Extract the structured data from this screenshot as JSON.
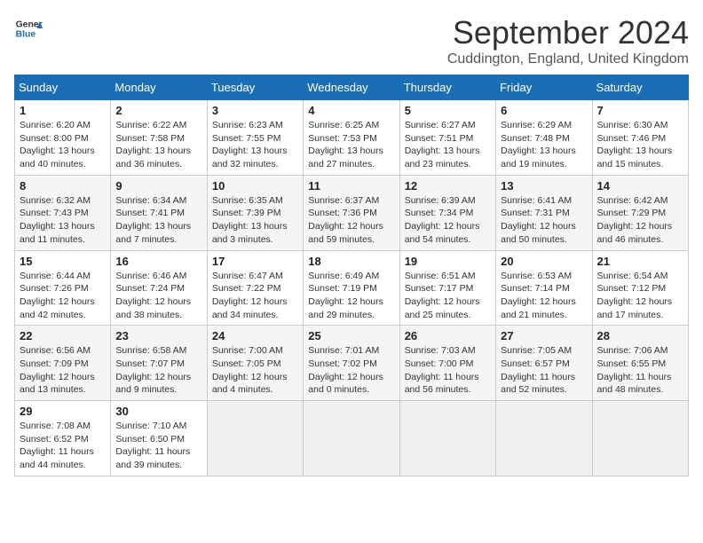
{
  "header": {
    "logo_line1": "General",
    "logo_line2": "Blue",
    "month": "September 2024",
    "location": "Cuddington, England, United Kingdom"
  },
  "weekdays": [
    "Sunday",
    "Monday",
    "Tuesday",
    "Wednesday",
    "Thursday",
    "Friday",
    "Saturday"
  ],
  "weeks": [
    [
      {
        "day": "1",
        "info": "Sunrise: 6:20 AM\nSunset: 8:00 PM\nDaylight: 13 hours\nand 40 minutes."
      },
      {
        "day": "2",
        "info": "Sunrise: 6:22 AM\nSunset: 7:58 PM\nDaylight: 13 hours\nand 36 minutes."
      },
      {
        "day": "3",
        "info": "Sunrise: 6:23 AM\nSunset: 7:55 PM\nDaylight: 13 hours\nand 32 minutes."
      },
      {
        "day": "4",
        "info": "Sunrise: 6:25 AM\nSunset: 7:53 PM\nDaylight: 13 hours\nand 27 minutes."
      },
      {
        "day": "5",
        "info": "Sunrise: 6:27 AM\nSunset: 7:51 PM\nDaylight: 13 hours\nand 23 minutes."
      },
      {
        "day": "6",
        "info": "Sunrise: 6:29 AM\nSunset: 7:48 PM\nDaylight: 13 hours\nand 19 minutes."
      },
      {
        "day": "7",
        "info": "Sunrise: 6:30 AM\nSunset: 7:46 PM\nDaylight: 13 hours\nand 15 minutes."
      }
    ],
    [
      {
        "day": "8",
        "info": "Sunrise: 6:32 AM\nSunset: 7:43 PM\nDaylight: 13 hours\nand 11 minutes."
      },
      {
        "day": "9",
        "info": "Sunrise: 6:34 AM\nSunset: 7:41 PM\nDaylight: 13 hours\nand 7 minutes."
      },
      {
        "day": "10",
        "info": "Sunrise: 6:35 AM\nSunset: 7:39 PM\nDaylight: 13 hours\nand 3 minutes."
      },
      {
        "day": "11",
        "info": "Sunrise: 6:37 AM\nSunset: 7:36 PM\nDaylight: 12 hours\nand 59 minutes."
      },
      {
        "day": "12",
        "info": "Sunrise: 6:39 AM\nSunset: 7:34 PM\nDaylight: 12 hours\nand 54 minutes."
      },
      {
        "day": "13",
        "info": "Sunrise: 6:41 AM\nSunset: 7:31 PM\nDaylight: 12 hours\nand 50 minutes."
      },
      {
        "day": "14",
        "info": "Sunrise: 6:42 AM\nSunset: 7:29 PM\nDaylight: 12 hours\nand 46 minutes."
      }
    ],
    [
      {
        "day": "15",
        "info": "Sunrise: 6:44 AM\nSunset: 7:26 PM\nDaylight: 12 hours\nand 42 minutes."
      },
      {
        "day": "16",
        "info": "Sunrise: 6:46 AM\nSunset: 7:24 PM\nDaylight: 12 hours\nand 38 minutes."
      },
      {
        "day": "17",
        "info": "Sunrise: 6:47 AM\nSunset: 7:22 PM\nDaylight: 12 hours\nand 34 minutes."
      },
      {
        "day": "18",
        "info": "Sunrise: 6:49 AM\nSunset: 7:19 PM\nDaylight: 12 hours\nand 29 minutes."
      },
      {
        "day": "19",
        "info": "Sunrise: 6:51 AM\nSunset: 7:17 PM\nDaylight: 12 hours\nand 25 minutes."
      },
      {
        "day": "20",
        "info": "Sunrise: 6:53 AM\nSunset: 7:14 PM\nDaylight: 12 hours\nand 21 minutes."
      },
      {
        "day": "21",
        "info": "Sunrise: 6:54 AM\nSunset: 7:12 PM\nDaylight: 12 hours\nand 17 minutes."
      }
    ],
    [
      {
        "day": "22",
        "info": "Sunrise: 6:56 AM\nSunset: 7:09 PM\nDaylight: 12 hours\nand 13 minutes."
      },
      {
        "day": "23",
        "info": "Sunrise: 6:58 AM\nSunset: 7:07 PM\nDaylight: 12 hours\nand 9 minutes."
      },
      {
        "day": "24",
        "info": "Sunrise: 7:00 AM\nSunset: 7:05 PM\nDaylight: 12 hours\nand 4 minutes."
      },
      {
        "day": "25",
        "info": "Sunrise: 7:01 AM\nSunset: 7:02 PM\nDaylight: 12 hours\nand 0 minutes."
      },
      {
        "day": "26",
        "info": "Sunrise: 7:03 AM\nSunset: 7:00 PM\nDaylight: 11 hours\nand 56 minutes."
      },
      {
        "day": "27",
        "info": "Sunrise: 7:05 AM\nSunset: 6:57 PM\nDaylight: 11 hours\nand 52 minutes."
      },
      {
        "day": "28",
        "info": "Sunrise: 7:06 AM\nSunset: 6:55 PM\nDaylight: 11 hours\nand 48 minutes."
      }
    ],
    [
      {
        "day": "29",
        "info": "Sunrise: 7:08 AM\nSunset: 6:52 PM\nDaylight: 11 hours\nand 44 minutes."
      },
      {
        "day": "30",
        "info": "Sunrise: 7:10 AM\nSunset: 6:50 PM\nDaylight: 11 hours\nand 39 minutes."
      },
      {
        "day": "",
        "info": ""
      },
      {
        "day": "",
        "info": ""
      },
      {
        "day": "",
        "info": ""
      },
      {
        "day": "",
        "info": ""
      },
      {
        "day": "",
        "info": ""
      }
    ]
  ]
}
